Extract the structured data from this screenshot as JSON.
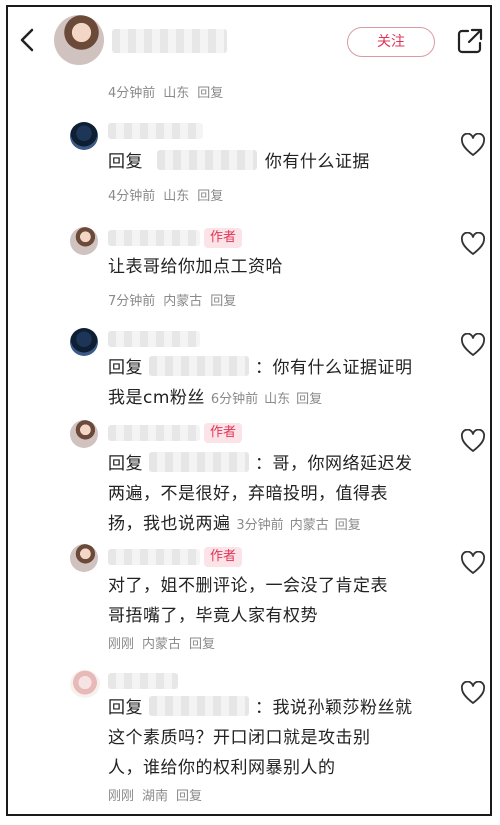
{
  "header": {
    "back_icon": "chevron-left-icon",
    "follow_label": "关注",
    "share_icon": "share-external-icon",
    "meta": {
      "time": "4分钟前",
      "location": "山东",
      "reply": "回复"
    }
  },
  "comments": [
    {
      "reply_prefix": "回复",
      "text": "你有什么证据",
      "time": "4分钟前",
      "location": "山东",
      "reply": "回复"
    },
    {
      "author_tag": "作者",
      "text": "让表哥给你加点工资哈",
      "time": "7分钟前",
      "location": "内蒙古",
      "reply": "回复"
    },
    {
      "reply_prefix": "回复",
      "line1": "：你有什么证据证明",
      "line2": "我是cm粉丝",
      "time": "6分钟前",
      "location": "山东",
      "reply": "回复"
    },
    {
      "author_tag": "作者",
      "reply_prefix": "回复",
      "line1": "：哥，你网络延迟发",
      "line2": "两遍，不是很好，弃暗投明，值得表",
      "line3": "扬，我也说两遍",
      "time": "3分钟前",
      "location": "内蒙古",
      "reply": "回复"
    },
    {
      "author_tag": "作者",
      "line1": "对了，姐不删评论，一会没了肯定表",
      "line2": "哥捂嘴了，毕竟人家有权势",
      "time": "刚刚",
      "location": "内蒙古",
      "reply": "回复"
    },
    {
      "reply_prefix": "回复",
      "line1": "：我说孙颖莎粉丝就",
      "line2": "这个素质吗？开口闭口就是攻击别",
      "line3": "人，谁给你的权利网暴别人的",
      "time": "刚刚",
      "location": "湖南",
      "reply": "回复"
    }
  ],
  "colors": {
    "accent": "#e03557",
    "meta": "#8a8a8a",
    "tag_bg": "#fbe3e8"
  }
}
